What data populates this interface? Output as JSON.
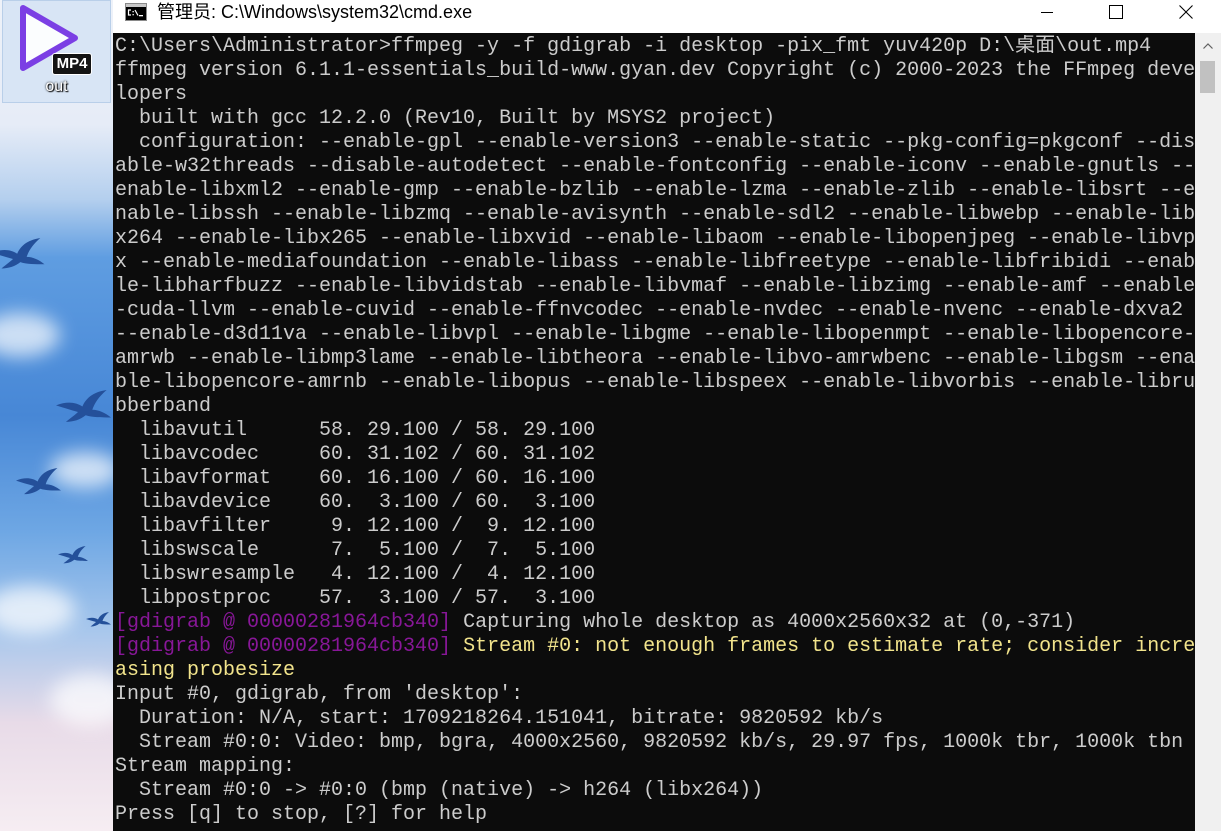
{
  "desktop": {
    "icon": {
      "badge": "MP4",
      "label": "out",
      "glyph": "play-icon"
    }
  },
  "window": {
    "title": "管理员: C:\\Windows\\system32\\cmd.exe",
    "app_icon": "cmd-icon",
    "controls": {
      "minimize": "minimize-icon",
      "maximize": "maximize-icon",
      "close": "close-icon"
    }
  },
  "console": {
    "lines": [
      {
        "text": "C:\\Users\\Administrator>ffmpeg -y -f gdigrab -i desktop -pix_fmt yuv420p D:\\桌面\\out.mp4"
      },
      {
        "text": "ffmpeg version 6.1.1-essentials_build-www.gyan.dev Copyright (c) 2000-2023 the FFmpeg deve"
      },
      {
        "text": "lopers"
      },
      {
        "text": "  built with gcc 12.2.0 (Rev10, Built by MSYS2 project)"
      },
      {
        "text": "  configuration: --enable-gpl --enable-version3 --enable-static --pkg-config=pkgconf --dis"
      },
      {
        "text": "able-w32threads --disable-autodetect --enable-fontconfig --enable-iconv --enable-gnutls --"
      },
      {
        "text": "enable-libxml2 --enable-gmp --enable-bzlib --enable-lzma --enable-zlib --enable-libsrt --e"
      },
      {
        "text": "nable-libssh --enable-libzmq --enable-avisynth --enable-sdl2 --enable-libwebp --enable-lib"
      },
      {
        "text": "x264 --enable-libx265 --enable-libxvid --enable-libaom --enable-libopenjpeg --enable-libvp"
      },
      {
        "text": "x --enable-mediafoundation --enable-libass --enable-libfreetype --enable-libfribidi --enab"
      },
      {
        "text": "le-libharfbuzz --enable-libvidstab --enable-libvmaf --enable-libzimg --enable-amf --enable"
      },
      {
        "text": "-cuda-llvm --enable-cuvid --enable-ffnvcodec --enable-nvdec --enable-nvenc --enable-dxva2"
      },
      {
        "text": "--enable-d3d11va --enable-libvpl --enable-libgme --enable-libopenmpt --enable-libopencore-"
      },
      {
        "text": "amrwb --enable-libmp3lame --enable-libtheora --enable-libvo-amrwbenc --enable-libgsm --ena"
      },
      {
        "text": "ble-libopencore-amrnb --enable-libopus --enable-libspeex --enable-libvorbis --enable-libru"
      },
      {
        "text": "bberband"
      },
      {
        "text": "  libavutil      58. 29.100 / 58. 29.100"
      },
      {
        "text": "  libavcodec     60. 31.102 / 60. 31.102"
      },
      {
        "text": "  libavformat    60. 16.100 / 60. 16.100"
      },
      {
        "text": "  libavdevice    60.  3.100 / 60.  3.100"
      },
      {
        "text": "  libavfilter     9. 12.100 /  9. 12.100"
      },
      {
        "text": "  libswscale      7.  5.100 /  7.  5.100"
      },
      {
        "text": "  libswresample   4. 12.100 /  4. 12.100"
      },
      {
        "text": "  libpostproc    57.  3.100 / 57.  3.100"
      },
      {
        "prefix": "[gdigrab @ 00000281964cb340]",
        "text": "Capturing whole desktop as 4000x2560x32 at (0,-371)"
      },
      {
        "prefix": "[gdigrab @ 00000281964cb340]",
        "text": "Stream #0: not enough frames to estimate rate; consider incre"
      },
      {
        "text": "asing probesize"
      },
      {
        "text": "Input #0, gdigrab, from 'desktop':"
      },
      {
        "text": "  Duration: N/A, start: 1709218264.151041, bitrate: 9820592 kb/s"
      },
      {
        "text": "  Stream #0:0: Video: bmp, bgra, 4000x2560, 9820592 kb/s, 29.97 fps, 1000k tbr, 1000k tbn"
      },
      {
        "text": "Stream mapping:"
      },
      {
        "text": "  Stream #0:0 -> #0:0 (bmp (native) -> h264 (libx264))"
      },
      {
        "text": "Press [q] to stop, [?] for help"
      }
    ]
  },
  "colors": {
    "console_bg": "#0c0c0c",
    "console_fg": "#cccccc",
    "log_prefix": "#881798",
    "warning": "#f2e48c",
    "titlebar_bg": "#ffffff",
    "icon_accent": "#7b3fe4",
    "scrollbar_track": "#f0f0f0",
    "scrollbar_thumb": "#c1c1c1"
  }
}
